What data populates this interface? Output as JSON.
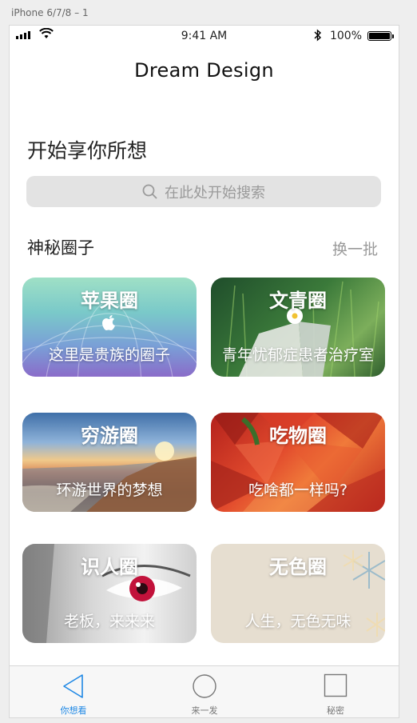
{
  "artboard": {
    "label": "iPhone 6/7/8 – 1"
  },
  "status_bar": {
    "time": "9:41 AM",
    "battery_text": "100%",
    "battery_level": 1.0
  },
  "header": {
    "title": "Dream Design"
  },
  "main": {
    "headline": "开始享你所想",
    "search": {
      "placeholder": "在此处开始搜索"
    },
    "section": {
      "title": "神秘圈子",
      "refresh_label": "换一批"
    },
    "cards": [
      {
        "title": "苹果圈",
        "subtitle": "这里是贵族的圈子"
      },
      {
        "title": "文青圈",
        "subtitle": "青年忧郁症患者治疗室"
      },
      {
        "title": "穷游圈",
        "subtitle": "环游世界的梦想"
      },
      {
        "title": "吃物圈",
        "subtitle": "吃啥都一样吗?"
      },
      {
        "title": "识人圈",
        "subtitle": "老板，来来来"
      },
      {
        "title": "无色圈",
        "subtitle": "人生，无色无味"
      }
    ]
  },
  "tab_bar": {
    "tabs": [
      {
        "label": "你想看",
        "icon": "triangle-icon",
        "active": true
      },
      {
        "label": "来一发",
        "icon": "circle-icon",
        "active": false
      },
      {
        "label": "秘密",
        "icon": "square-icon",
        "active": false
      }
    ]
  },
  "colors": {
    "accent": "#1e88e5",
    "search_bg": "#e3e3e3",
    "muted_text": "#9a9a9a"
  }
}
